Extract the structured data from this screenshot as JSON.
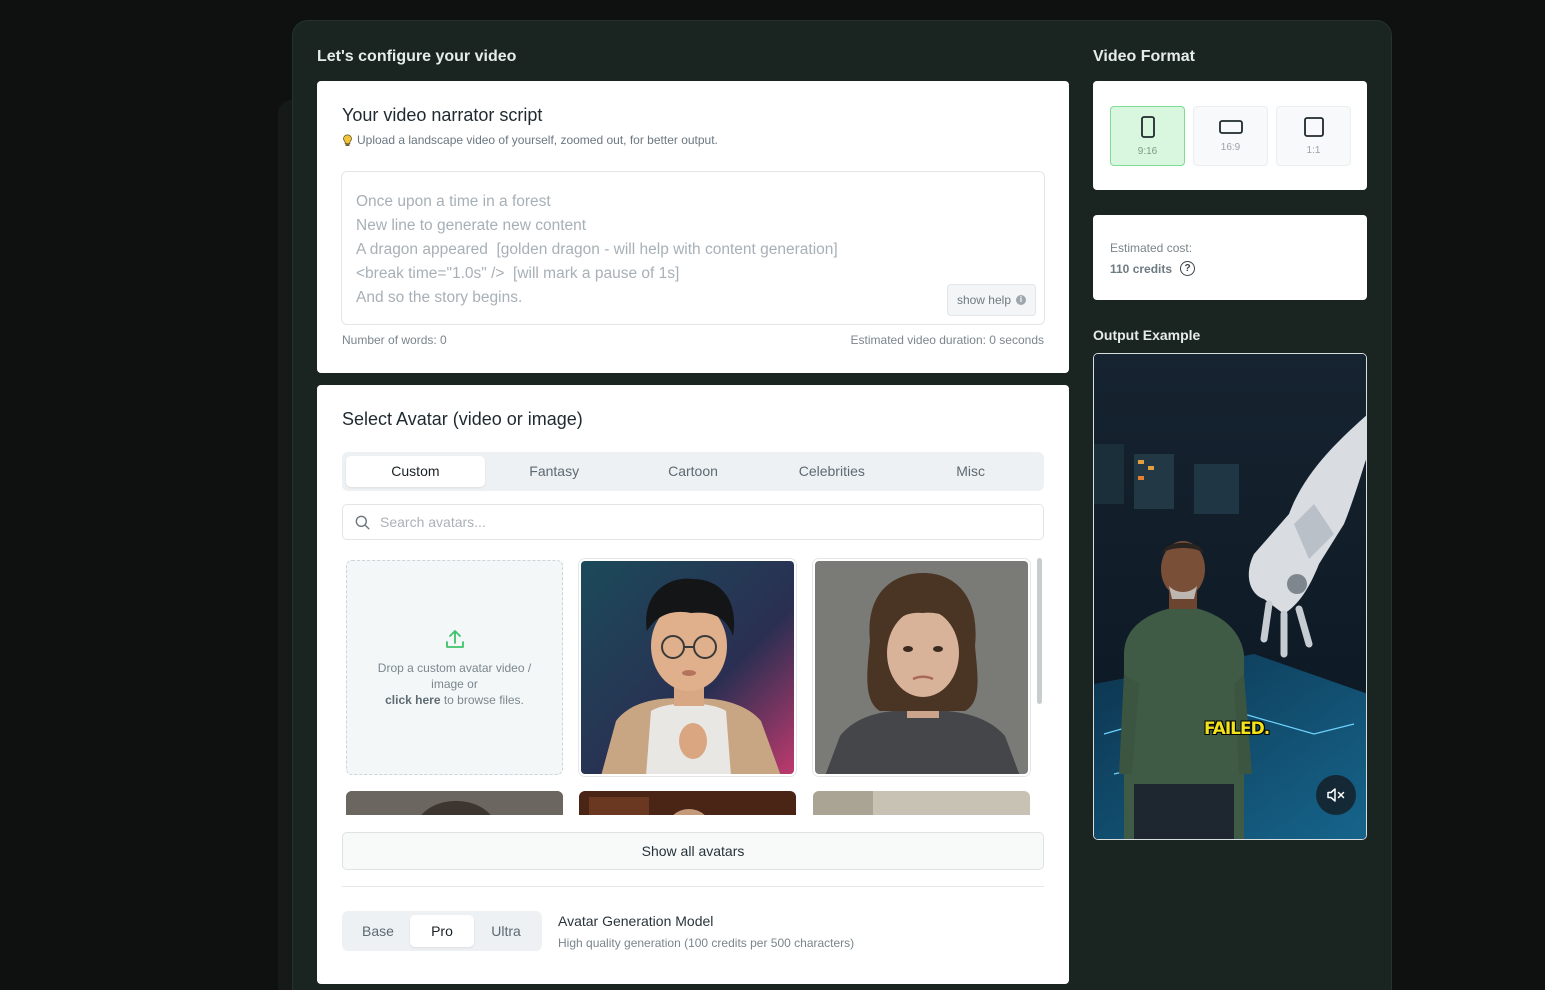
{
  "config": {
    "title": "Let's configure your video"
  },
  "script_card": {
    "title": "Your video narrator script",
    "tip": "Upload a landscape video of yourself, zoomed out, for better output.",
    "placeholder_lines": [
      "Once upon a time in a forest",
      "New line to generate new content",
      "A dragon appeared  [golden dragon - will help with content generation]",
      "<break time=\"1.0s\" />  [will mark a pause of 1s]",
      "And so the story begins."
    ],
    "show_help": "show help",
    "words": "Number of words: 0",
    "duration": "Estimated video duration: 0 seconds"
  },
  "avatar_card": {
    "title": "Select Avatar (video or image)",
    "tabs": [
      {
        "label": "Custom",
        "active": true
      },
      {
        "label": "Fantasy",
        "active": false
      },
      {
        "label": "Cartoon",
        "active": false
      },
      {
        "label": "Celebrities",
        "active": false
      },
      {
        "label": "Misc",
        "active": false
      }
    ],
    "search_placeholder": "Search avatars...",
    "drop_line1": "Drop a custom avatar video / image or",
    "drop_link": "click here",
    "drop_line2": " to browse files.",
    "show_all": "Show all avatars",
    "model_options": [
      {
        "label": "Base",
        "active": false
      },
      {
        "label": "Pro",
        "active": true
      },
      {
        "label": "Ultra",
        "active": false
      }
    ],
    "model_title": "Avatar Generation Model",
    "model_desc": "High quality generation (100 credits per 500 characters)"
  },
  "video_format": {
    "title": "Video Format",
    "options": [
      {
        "label": "9:16",
        "active": true
      },
      {
        "label": "16:9",
        "active": false
      },
      {
        "label": "1:1",
        "active": false
      }
    ]
  },
  "cost": {
    "label": "Estimated cost:",
    "value": "110 credits"
  },
  "output_example": {
    "title": "Output Example",
    "caption": "FAILED."
  },
  "colors": {
    "accent_green": "#7edc93",
    "panel_bg": "#1a2420",
    "page_bg": "#0f1110"
  }
}
